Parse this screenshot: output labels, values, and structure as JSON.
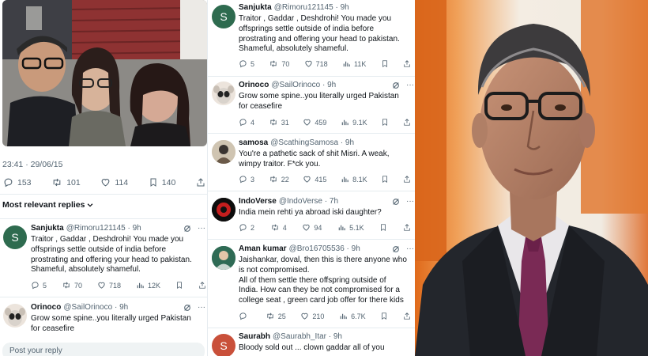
{
  "left": {
    "timestamp": "23:41 · 29/06/15",
    "stats": [
      {
        "icon": "reply-icon",
        "value": "153"
      },
      {
        "icon": "retweet-icon",
        "value": "101"
      },
      {
        "icon": "like-icon",
        "value": "114"
      },
      {
        "icon": "bookmark-icon",
        "value": "140"
      },
      {
        "icon": "share-icon",
        "value": ""
      }
    ],
    "sort_label": "Most relevant replies",
    "replies": [
      {
        "name": "Sanjukta",
        "handle": "@Rimoru121145 · 9h",
        "avatar_letter": "S",
        "lines": [
          "Traitor , Gaddar , Deshdrohi! You made you",
          "offsprings settle outside of india before",
          "prostrating and offering your head to pakistan.",
          "Shameful, absolutely shameful."
        ],
        "replies": "5",
        "retweets": "70",
        "likes": "718",
        "views": "12K"
      },
      {
        "name": "Orinoco",
        "handle": "@SailOrinoco · 9h",
        "lines": [
          "Grow some spine..you literally urged Pakistan",
          "for ceasefire"
        ]
      }
    ],
    "post_reply_placeholder": "Post your reply"
  },
  "middle": {
    "replies": [
      {
        "name": "Sanjukta",
        "handle": "@Rimoru121145 · 9h",
        "avatar_letter": "S",
        "lines": [
          "Traitor , Gaddar , Deshdrohi! You made you",
          "offsprings settle outside of india before",
          "prostrating and offering your head to pakistan.",
          "Shameful, absolutely shameful."
        ],
        "replies": "5",
        "retweets": "70",
        "likes": "718",
        "views": "11K"
      },
      {
        "name": "Orinoco",
        "handle": "@SailOrinoco · 9h",
        "lines": [
          "Grow some spine..you literally urged Pakistan",
          "for ceasefire"
        ],
        "replies": "4",
        "retweets": "31",
        "likes": "459",
        "views": "9.1K"
      },
      {
        "name": "samosa",
        "handle": "@ScathingSamosa · 9h",
        "lines": [
          "You're a pathetic sack of shit Misri. A weak,",
          "wimpy traitor. F*ck you."
        ],
        "replies": "3",
        "retweets": "22",
        "likes": "415",
        "views": "8.1K"
      },
      {
        "name": "IndoVerse",
        "handle": "@IndoVerse · 7h",
        "lines": [
          "India mein rehti ya abroad iski daughter?"
        ],
        "replies": "2",
        "retweets": "4",
        "likes": "94",
        "views": "5.1K"
      },
      {
        "name": "Aman kumar",
        "handle": "@Bro16705536 · 9h",
        "lines": [
          "Jaishankar, doval, then this is there anyone who",
          "is not compromised.",
          "All of them settle there offspring outside of",
          "India. How can they be not compromised for a",
          "college seat , green card job offer for there kids"
        ],
        "replies": "",
        "retweets": "25",
        "likes": "210",
        "views": "6.7K"
      },
      {
        "name": "Saurabh",
        "handle": "@Saurabh_Itar · 9h",
        "avatar_letter": "S",
        "lines": [
          "Bloody sold out ... clown gaddar all of you"
        ]
      }
    ]
  },
  "colors": {
    "sanjukta_avatar": "#2e6b4f",
    "saurabh_avatar": "#c9503a",
    "text_secondary": "#536471"
  }
}
